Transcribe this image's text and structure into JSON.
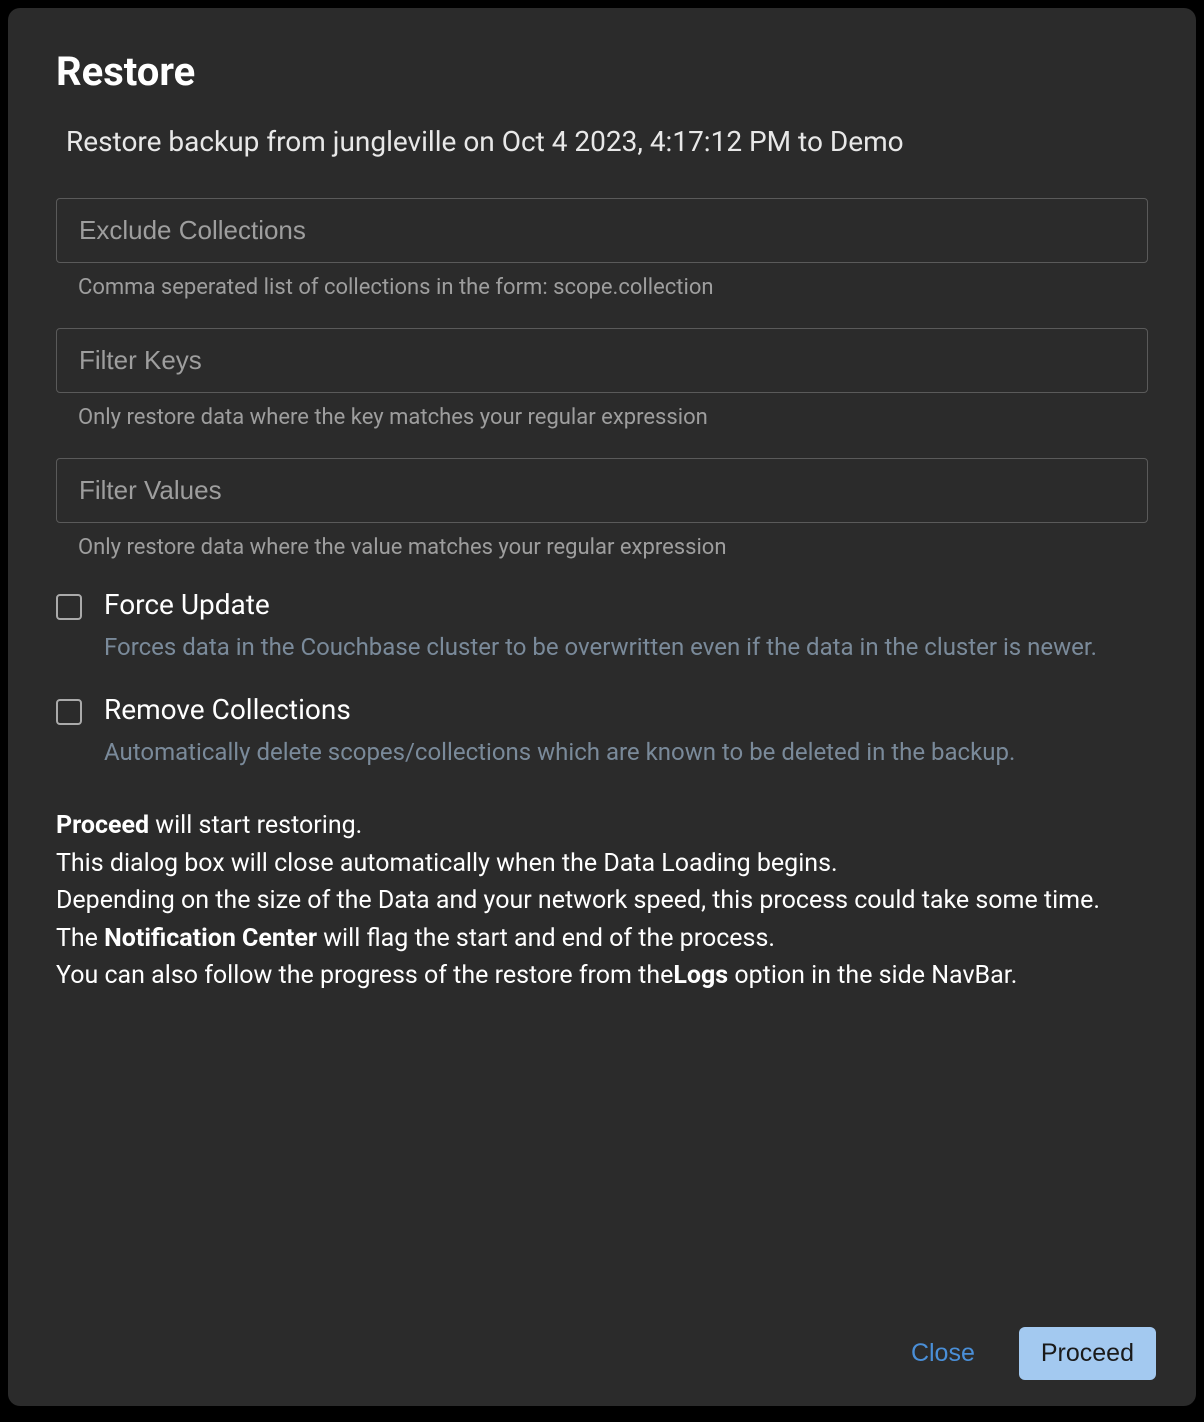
{
  "dialog": {
    "title": "Restore",
    "subtitle": "Restore backup from jungleville on Oct 4 2023, 4:17:12 PM to Demo"
  },
  "fields": {
    "excludeCollections": {
      "placeholder": "Exclude Collections",
      "value": "",
      "helper": "Comma seperated list of collections in the form: scope.collection"
    },
    "filterKeys": {
      "placeholder": "Filter Keys",
      "value": "",
      "helper": "Only restore data where the key matches your regular expression"
    },
    "filterValues": {
      "placeholder": "Filter Values",
      "value": "",
      "helper": "Only restore data where the value matches your regular expression"
    }
  },
  "checkboxes": {
    "forceUpdate": {
      "label": "Force Update",
      "description": "Forces data in the Couchbase cluster to be overwritten even if the data in the cluster is newer.",
      "checked": false
    },
    "removeCollections": {
      "label": "Remove Collections",
      "description": "Automatically delete scopes/collections which are known to be deleted in the backup.",
      "checked": false
    }
  },
  "info": {
    "proceed_bold": "Proceed",
    "proceed_rest": " will start restoring.",
    "line2": "This dialog box will close automatically when the Data Loading begins.",
    "line3": "Depending on the size of the Data and your network speed, this process could take some time.",
    "line4_pre": "The ",
    "line4_bold": "Notification Center",
    "line4_post": " will flag the start and end of the process.",
    "line5_pre": "You can also follow the progress of the restore from the",
    "line5_bold": "Logs",
    "line5_post": " option in the side NavBar."
  },
  "buttons": {
    "close": "Close",
    "proceed": "Proceed"
  }
}
